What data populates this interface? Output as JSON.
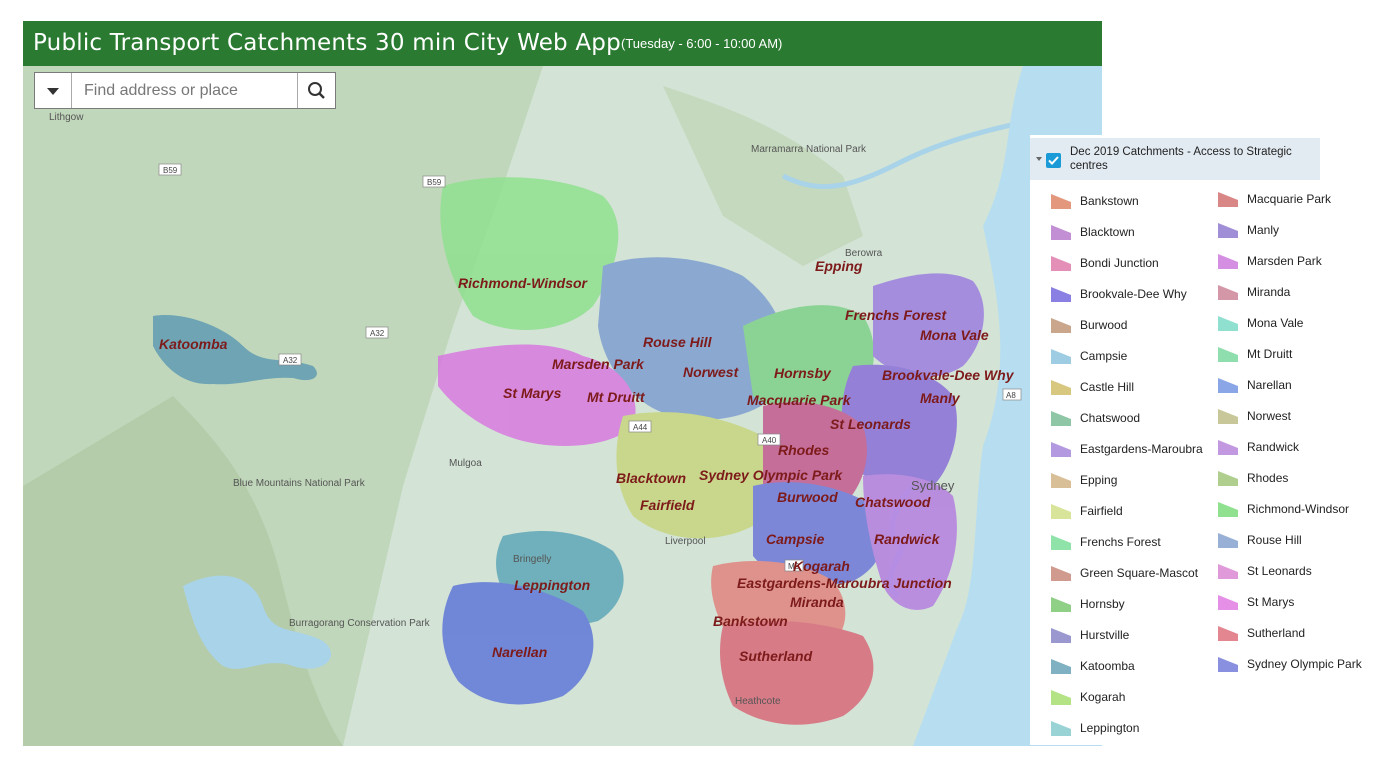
{
  "app": {
    "title": "Public Transport Catchments 30 min City Web App",
    "subtitle": "(Tuesday - 6:00 - 10:00 AM)"
  },
  "search": {
    "placeholder": "Find address or place"
  },
  "legend": {
    "layer_title": "Dec 2019 Catchments - Access to Strategic centres",
    "checked": true,
    "items": [
      {
        "label": "Bankstown",
        "color": "#e3987e"
      },
      {
        "label": "Blacktown",
        "color": "#c28fd4"
      },
      {
        "label": "Bondi Junction",
        "color": "#e38fb8"
      },
      {
        "label": "Brookvale-Dee Why",
        "color": "#8a7fe2"
      },
      {
        "label": "Burwood",
        "color": "#c9a68c"
      },
      {
        "label": "Campsie",
        "color": "#9ecde3"
      },
      {
        "label": "Castle Hill",
        "color": "#d8c77f"
      },
      {
        "label": "Chatswood",
        "color": "#8fc7a6"
      },
      {
        "label": "Eastgardens-Maroubra",
        "color": "#b39ae0"
      },
      {
        "label": "Epping",
        "color": "#d9bf98"
      },
      {
        "label": "Fairfield",
        "color": "#d8e49a"
      },
      {
        "label": "Frenchs Forest",
        "color": "#8fe3a8"
      },
      {
        "label": "Green Square-Mascot",
        "color": "#d09a8e"
      },
      {
        "label": "Hornsby",
        "color": "#8fcf86"
      },
      {
        "label": "Hurstville",
        "color": "#9a98cf"
      },
      {
        "label": "Katoomba",
        "color": "#7fb1c2"
      },
      {
        "label": "Kogarah",
        "color": "#b3e385"
      },
      {
        "label": "Leppington",
        "color": "#99d3d6"
      },
      {
        "label": "Macquarie Park",
        "color": "#d98686"
      },
      {
        "label": "Manly",
        "color": "#a08fd6"
      },
      {
        "label": "Marsden Park",
        "color": "#d48fe3"
      },
      {
        "label": "Miranda",
        "color": "#d497a8"
      },
      {
        "label": "Mona Vale",
        "color": "#8fe0cf"
      },
      {
        "label": "Mt Druitt",
        "color": "#8fdeae"
      },
      {
        "label": "Narellan",
        "color": "#8aa6e6"
      },
      {
        "label": "Norwest",
        "color": "#c7c79a"
      },
      {
        "label": "Randwick",
        "color": "#c299e0"
      },
      {
        "label": "Rhodes",
        "color": "#b0cf8e"
      },
      {
        "label": "Richmond-Windsor",
        "color": "#8fe08f"
      },
      {
        "label": "Rouse Hill",
        "color": "#99b0d6"
      },
      {
        "label": "St Leonards",
        "color": "#e09ad9"
      },
      {
        "label": "St Marys",
        "color": "#e58fe6"
      },
      {
        "label": "Sutherland",
        "color": "#e3868f"
      },
      {
        "label": "Sydney Olympic Park",
        "color": "#8a90e0"
      }
    ]
  },
  "map": {
    "catchment_labels": [
      "Richmond-Windsor",
      "Katoomba",
      "Rouse Hill",
      "Marsden Park",
      "St Marys",
      "Mt Druitt",
      "Norwest",
      "Hornsby",
      "Epping",
      "Frenchs Forest",
      "Mona Vale",
      "Brookvale-Dee Why",
      "Manly",
      "Macquarie Park",
      "St Leonards",
      "Rhodes",
      "Blacktown",
      "Sydney Olympic Park",
      "Fairfield",
      "Burwood",
      "Chatswood",
      "Randwick",
      "Campsie",
      "Kogarah",
      "Eastgardens-Maroubra Junction",
      "Leppington",
      "Miranda",
      "Bankstown",
      "Narellan",
      "Sutherland"
    ],
    "place_labels": [
      "Lithgow",
      "Marramarra National Park",
      "Berowra",
      "Blue Mountains National Park",
      "Mulgoa",
      "Bringelly",
      "Liverpool",
      "Sydney",
      "Burragorang Conservation Park",
      "Heathcote"
    ],
    "road_shields": [
      "B59",
      "B59",
      "A32",
      "A32",
      "A44",
      "A40",
      "A8",
      "M5"
    ],
    "colors": {
      "land": "#c8dfd2",
      "ocean": "#b6def0",
      "forest": "#b5cca8"
    }
  }
}
